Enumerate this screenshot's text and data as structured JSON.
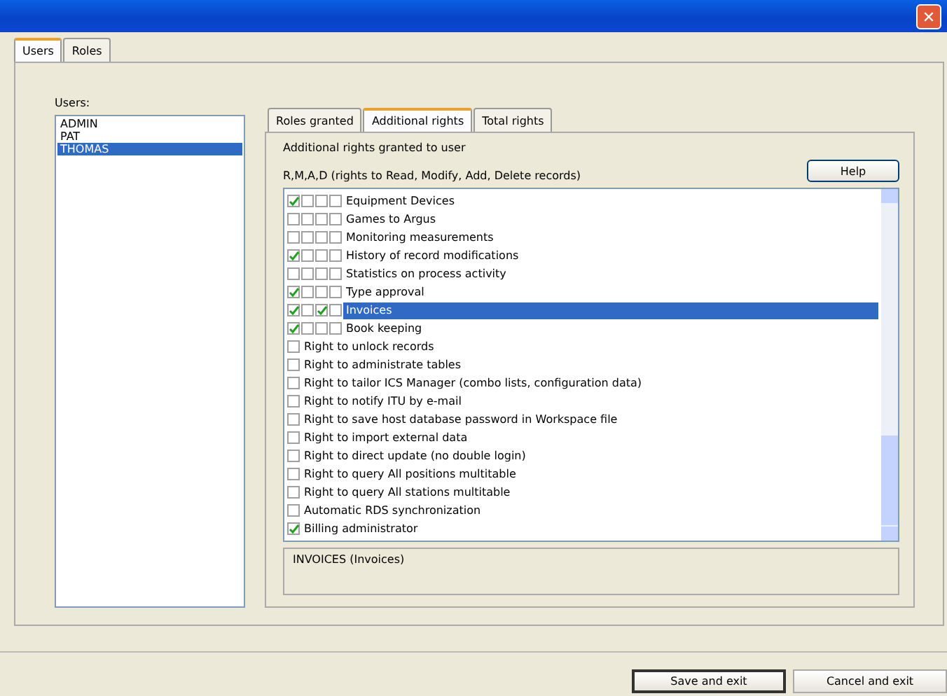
{
  "window": {
    "close": "✕"
  },
  "tabs": [
    {
      "label": "Users",
      "selected": true
    },
    {
      "label": "Roles",
      "selected": false
    }
  ],
  "users": {
    "label": "Users:",
    "items": [
      {
        "name": "ADMIN",
        "selected": false
      },
      {
        "name": "PAT",
        "selected": false
      },
      {
        "name": "THOMAS",
        "selected": true
      }
    ]
  },
  "rights_tabs": [
    {
      "label": "Roles granted",
      "selected": false
    },
    {
      "label": "Additional rights",
      "selected": true
    },
    {
      "label": "Total rights",
      "selected": false
    }
  ],
  "heading": "Additional rights granted to user",
  "legend": "R,M,A,D (rights to Read, Modify, Add, Delete records)",
  "help_button": "Help",
  "rights": [
    {
      "kind": "rmad",
      "label": "Equipment Devices",
      "checks": [
        true,
        false,
        false,
        false
      ],
      "selected": false
    },
    {
      "kind": "rmad",
      "label": "Games to Argus",
      "checks": [
        false,
        false,
        false,
        false
      ],
      "selected": false
    },
    {
      "kind": "rmad",
      "label": "Monitoring measurements",
      "checks": [
        false,
        false,
        false,
        false
      ],
      "selected": false
    },
    {
      "kind": "rmad",
      "label": "History of record modifications",
      "checks": [
        true,
        false,
        false,
        false
      ],
      "selected": false
    },
    {
      "kind": "rmad",
      "label": "Statistics on process activity",
      "checks": [
        false,
        false,
        false,
        false
      ],
      "selected": false
    },
    {
      "kind": "rmad",
      "label": "Type approval",
      "checks": [
        true,
        false,
        false,
        false
      ],
      "selected": false
    },
    {
      "kind": "rmad",
      "label": "Invoices",
      "checks": [
        true,
        false,
        true,
        false
      ],
      "selected": true
    },
    {
      "kind": "rmad",
      "label": "Book keeping",
      "checks": [
        true,
        false,
        false,
        false
      ],
      "selected": false
    },
    {
      "kind": "single",
      "label": "Right to unlock records",
      "checks": [
        false
      ],
      "selected": false
    },
    {
      "kind": "single",
      "label": "Right to administrate tables",
      "checks": [
        false
      ],
      "selected": false
    },
    {
      "kind": "single",
      "label": "Right to tailor ICS Manager (combo lists, configuration data)",
      "checks": [
        false
      ],
      "selected": false
    },
    {
      "kind": "single",
      "label": "Right to notify ITU by e-mail",
      "checks": [
        false
      ],
      "selected": false
    },
    {
      "kind": "single",
      "label": "Right to save host database password in Workspace file",
      "checks": [
        false
      ],
      "selected": false
    },
    {
      "kind": "single",
      "label": "Right to import external data",
      "checks": [
        false
      ],
      "selected": false
    },
    {
      "kind": "single",
      "label": "Right to direct update (no double login)",
      "checks": [
        false
      ],
      "selected": false
    },
    {
      "kind": "single",
      "label": "Right to query All positions multitable",
      "checks": [
        false
      ],
      "selected": false
    },
    {
      "kind": "single",
      "label": "Right to query All stations multitable",
      "checks": [
        false
      ],
      "selected": false
    },
    {
      "kind": "single",
      "label": "Automatic RDS synchronization",
      "checks": [
        false
      ],
      "selected": false
    },
    {
      "kind": "single",
      "label": "Billing administrator",
      "checks": [
        true
      ],
      "selected": false
    }
  ],
  "description": "INVOICES (Invoices)",
  "buttons": [
    {
      "label": "Save and exit",
      "default": true
    },
    {
      "label": "Cancel and exit",
      "default": false
    }
  ]
}
